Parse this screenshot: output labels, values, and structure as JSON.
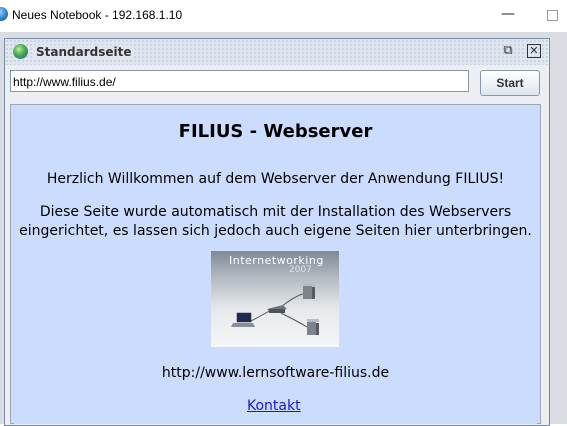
{
  "window": {
    "title": "Neues Notebook - 192.168.1.10",
    "minimize_glyph": "—"
  },
  "frame": {
    "title": "Standardseite",
    "restore_glyph": "⧉",
    "close_glyph": "✕"
  },
  "browser": {
    "url_value": "http://www.filius.de/",
    "start_label": "Start"
  },
  "page": {
    "heading": "FILIUS - Webserver",
    "welcome": "Herzlich Willkommen auf dem Webserver der Anwendung FILIUS!",
    "description_line1": "Diese Seite wurde automatisch mit der Installation des Webservers",
    "description_line2": "eingerichtet, es lassen sich jedoch auch eigene Seiten hier unterbringen.",
    "logo_title": "Internetworking",
    "logo_year": "2007",
    "site_url": "http://www.lernsoftware-filius.de",
    "contact_link": "Kontakt"
  },
  "colors": {
    "page_background": "#ccdcff",
    "link": "#1a1ad6"
  }
}
